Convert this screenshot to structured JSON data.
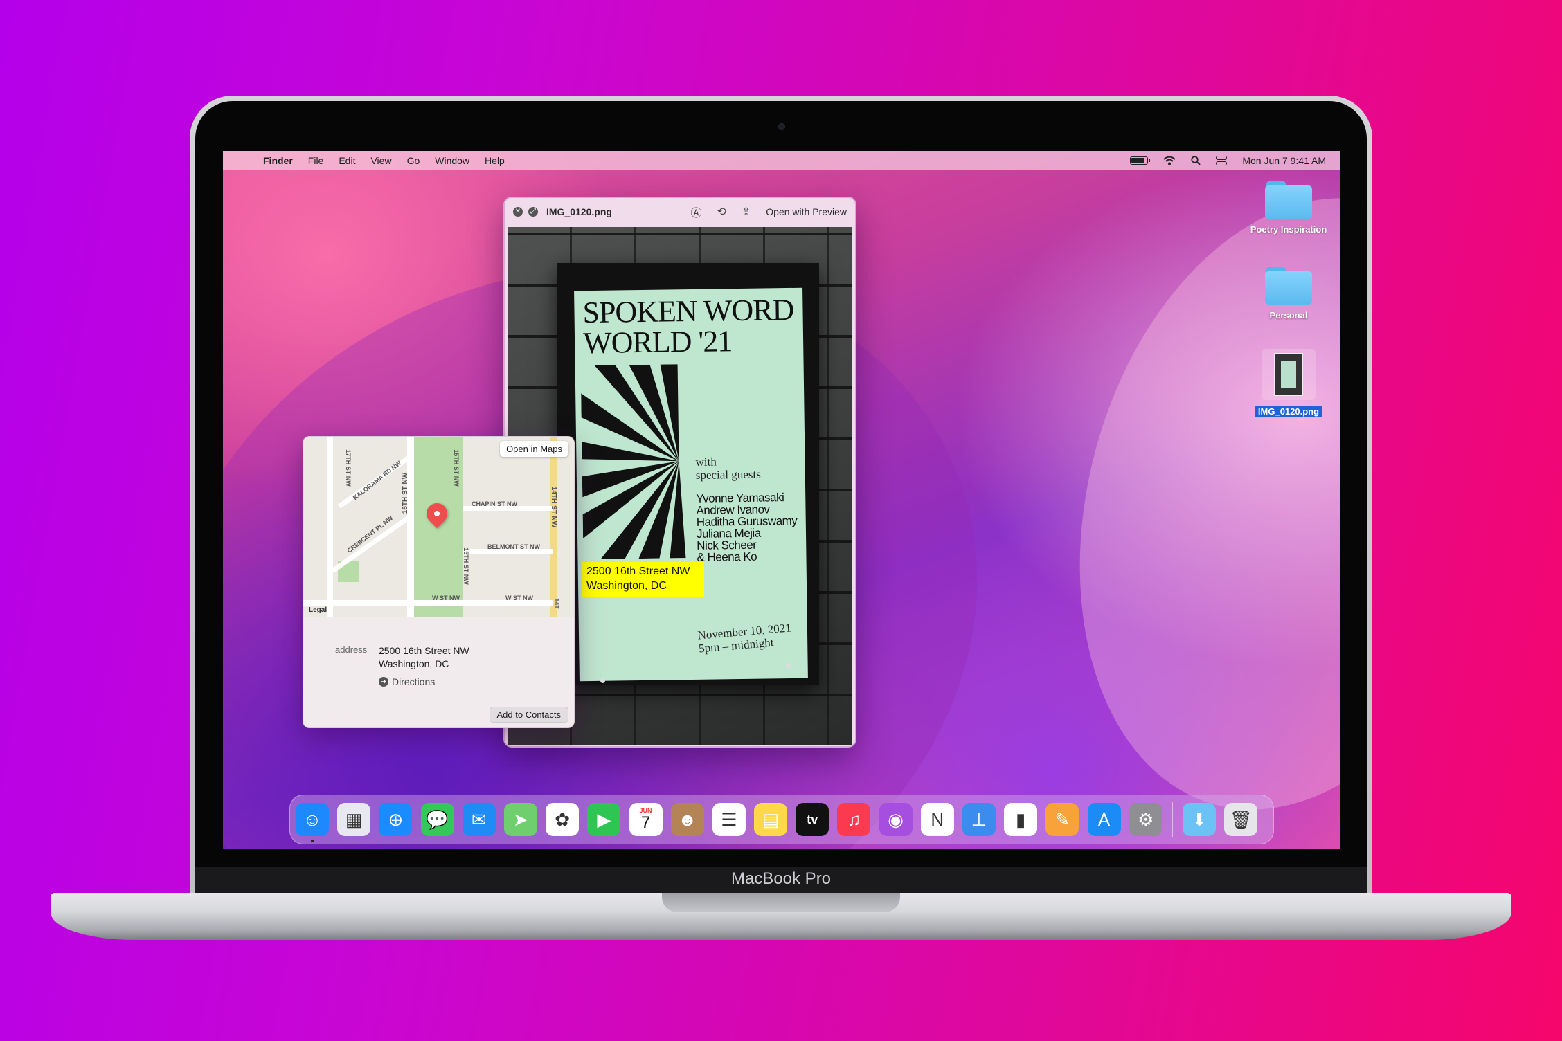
{
  "menubar": {
    "app": "Finder",
    "items": [
      "File",
      "Edit",
      "View",
      "Go",
      "Window",
      "Help"
    ],
    "clock": "Mon Jun 7  9:41 AM"
  },
  "desktop": {
    "items": [
      {
        "label": "Poetry Inspiration",
        "type": "folder"
      },
      {
        "label": "Personal",
        "type": "folder"
      },
      {
        "label": "IMG_0120.png",
        "type": "image",
        "selected": true
      }
    ]
  },
  "quicklook": {
    "title": "IMG_0120.png",
    "open_with": "Open with Preview"
  },
  "poster": {
    "title_line1": "SPOKEN WORD",
    "title_line2": "WORLD '21",
    "with": "with",
    "special": "special guests",
    "names": [
      "Yvonne Yamasaki",
      "Andrew Ivanov",
      "Haditha Guruswamy",
      "Juliana Mejia",
      "Nick Scheer",
      "& Heena Ko"
    ],
    "date_line1": "November 10, 2021",
    "date_line2": "5pm – midnight",
    "highlight_line1": "2500 16th Street NW",
    "highlight_line2": "Washington, DC"
  },
  "popover": {
    "open_in_maps": "Open in Maps",
    "legal": "Legal",
    "map_labels": {
      "st17": "17TH ST NW",
      "kalorama": "KALORAMA RD NW",
      "st16": "16TH ST NW",
      "st15a": "15TH ST NW",
      "chapin": "CHAPIN ST NW",
      "st14": "14TH ST NW",
      "crescent": "CRESCENT PL NW",
      "belmont": "BELMONT ST NW",
      "st15b": "15TH ST NW",
      "wst1": "W ST NW",
      "wst2": "W ST NW",
      "st14b": "14T"
    },
    "address_label": "address",
    "address_line1": "2500 16th Street NW",
    "address_line2": "Washington, DC",
    "directions": "Directions",
    "add_to_contacts": "Add to Contacts"
  },
  "dock": {
    "apps": [
      {
        "name": "finder-icon",
        "color": "#1e88ff",
        "glyph": "☺"
      },
      {
        "name": "launchpad-icon",
        "color": "#e8e8f0",
        "glyph": "▦"
      },
      {
        "name": "safari-icon",
        "color": "#1a8cff",
        "glyph": "⊕"
      },
      {
        "name": "messages-icon",
        "color": "#34c759",
        "glyph": "💬"
      },
      {
        "name": "mail-icon",
        "color": "#1f8bf5",
        "glyph": "✉"
      },
      {
        "name": "maps-icon",
        "color": "#6fcf6f",
        "glyph": "➤"
      },
      {
        "name": "photos-icon",
        "color": "#ffffff",
        "glyph": "✿"
      },
      {
        "name": "facetime-icon",
        "color": "#2fc552",
        "glyph": "▶"
      },
      {
        "name": "calendar-icon",
        "color": "#ffffff",
        "glyph": "7"
      },
      {
        "name": "contacts-icon",
        "color": "#b58456",
        "glyph": "☻"
      },
      {
        "name": "reminders-icon",
        "color": "#ffffff",
        "glyph": "☰"
      },
      {
        "name": "notes-icon",
        "color": "#ffd84a",
        "glyph": "▤"
      },
      {
        "name": "tv-icon",
        "color": "#111111",
        "glyph": "tv"
      },
      {
        "name": "music-icon",
        "color": "#fb3a4f",
        "glyph": "♫"
      },
      {
        "name": "podcasts-icon",
        "color": "#a54ee0",
        "glyph": "◉"
      },
      {
        "name": "news-icon",
        "color": "#ffffff",
        "glyph": "N"
      },
      {
        "name": "keynote-icon",
        "color": "#3c8cf0",
        "glyph": "⊥"
      },
      {
        "name": "numbers-icon",
        "color": "#ffffff",
        "glyph": "▮"
      },
      {
        "name": "pages-icon",
        "color": "#f7a33a",
        "glyph": "✎"
      },
      {
        "name": "app-store-icon",
        "color": "#1b8cf6",
        "glyph": "A"
      },
      {
        "name": "system-preferences-icon",
        "color": "#8e8e93",
        "glyph": "⚙"
      }
    ],
    "calendar_month": "JUN",
    "tv_label": "tv",
    "trailing": [
      {
        "name": "downloads-folder-icon",
        "color": "#6cc2f4",
        "glyph": "⬇"
      },
      {
        "name": "trash-icon",
        "color": "#e5e5ea",
        "glyph": "🗑"
      }
    ]
  },
  "laptop": {
    "brand": "MacBook Pro"
  }
}
